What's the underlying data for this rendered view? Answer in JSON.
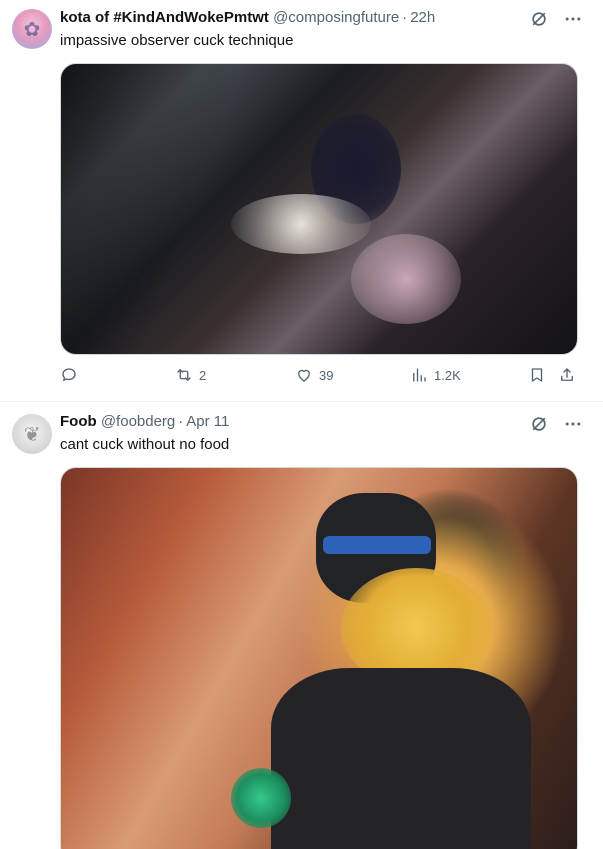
{
  "tweets": [
    {
      "display_name": "kota of #KindAndWokePmtwt",
      "handle": "@composingfuture",
      "time": "22h",
      "text": "impassive observer cuck technique",
      "stats": {
        "replies": "",
        "retweets": "2",
        "likes": "39",
        "views": "1.2K"
      }
    },
    {
      "display_name": "Foob",
      "handle": "@foobderg",
      "time": "Apr 11",
      "text": "cant cuck without no food"
    }
  ],
  "separator": "·",
  "icons": {
    "grok": "grok-icon",
    "more": "more-icon",
    "reply": "reply-icon",
    "retweet": "retweet-icon",
    "like": "heart-icon",
    "views": "views-icon",
    "bookmark": "bookmark-icon",
    "share": "share-icon"
  },
  "colors": {
    "text": "#0f1419",
    "secondary": "#536471",
    "border": "#eff3f4"
  }
}
